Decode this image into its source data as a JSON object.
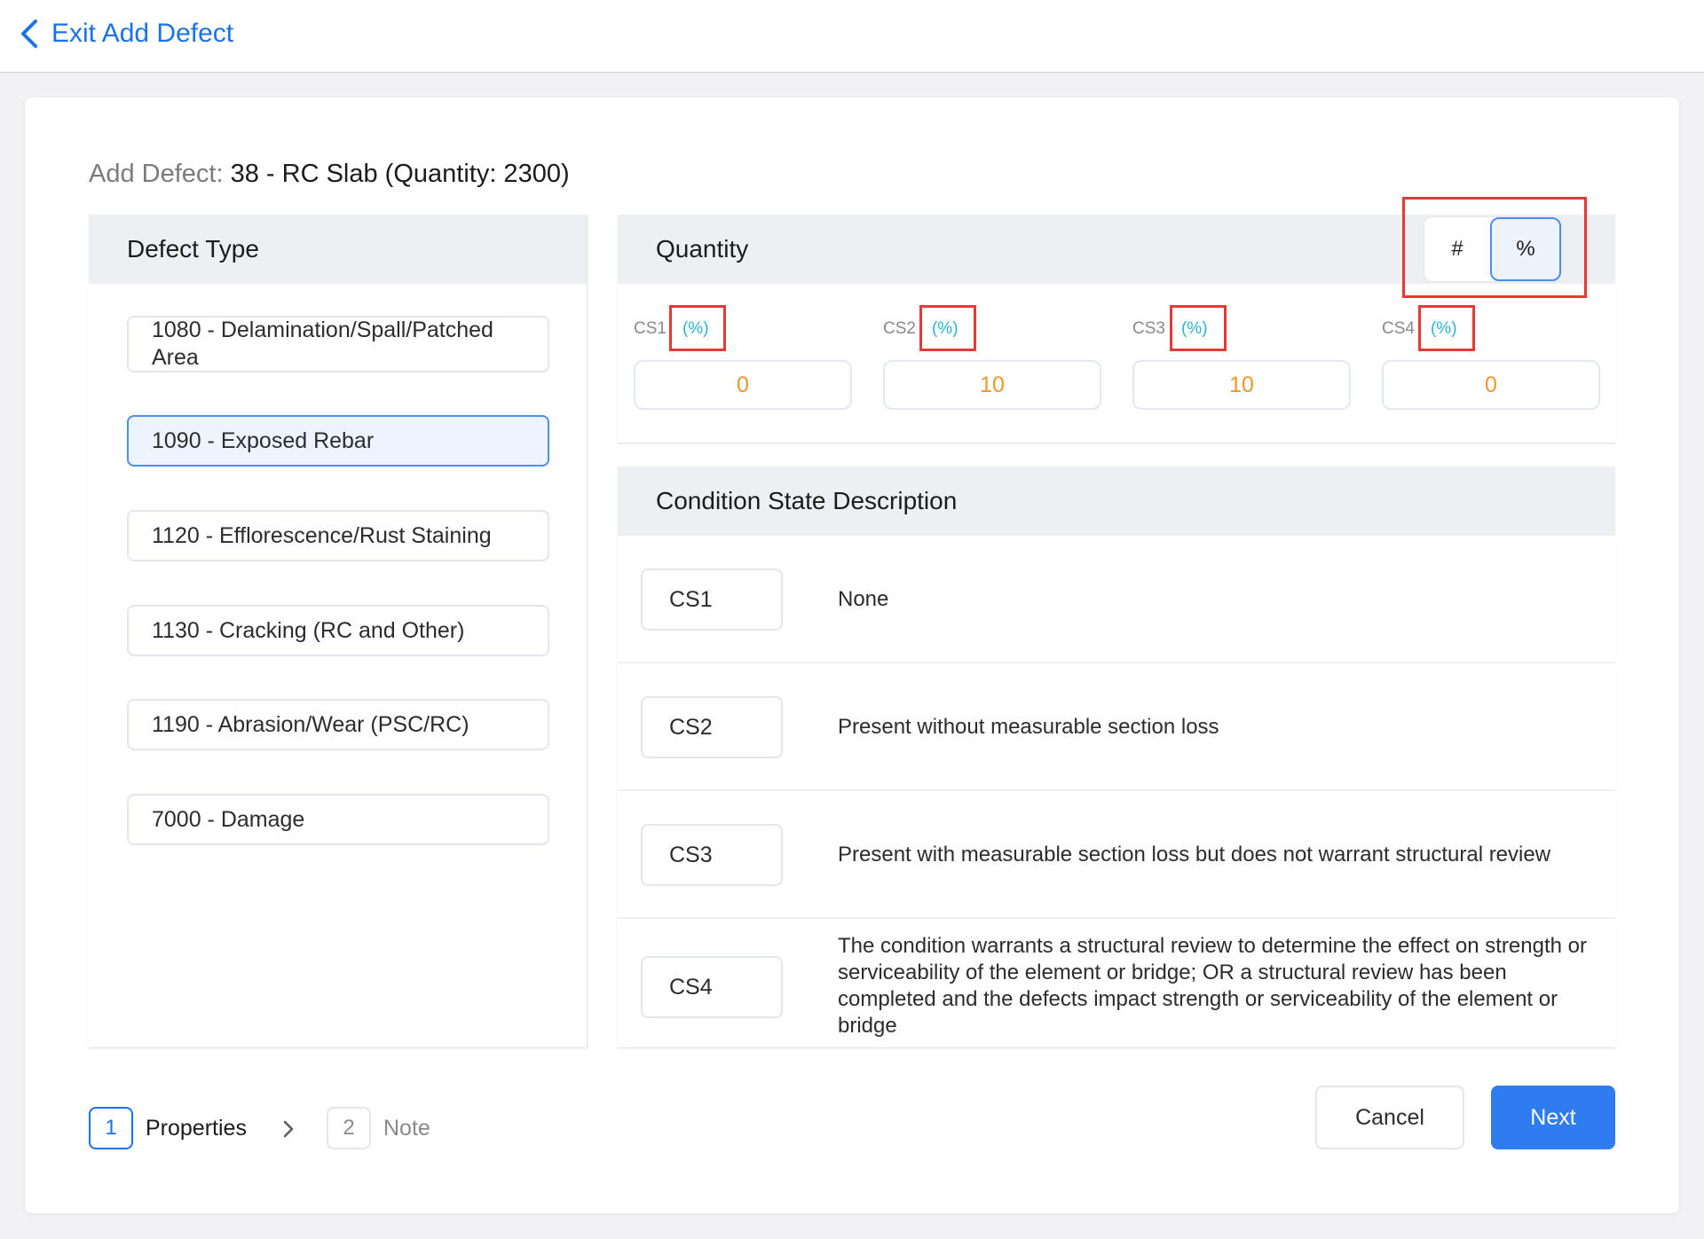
{
  "header": {
    "back_label": "Exit Add Defect"
  },
  "page": {
    "title_prefix": "Add Defect:",
    "title_value": "38 - RC Slab (Quantity: 2300)"
  },
  "defect_type": {
    "heading": "Defect Type",
    "items": [
      {
        "label": "1080 - Delamination/Spall/Patched Area",
        "selected": false
      },
      {
        "label": "1090 - Exposed Rebar",
        "selected": true
      },
      {
        "label": "1120 - Efflorescence/Rust Staining",
        "selected": false
      },
      {
        "label": "1130 - Cracking (RC and Other)",
        "selected": false
      },
      {
        "label": "1190 - Abrasion/Wear (PSC/RC)",
        "selected": false
      },
      {
        "label": "7000 - Damage",
        "selected": false
      }
    ]
  },
  "quantity": {
    "heading": "Quantity",
    "toggle": {
      "count_label": "#",
      "percent_label": "%",
      "active": "%"
    },
    "fields": [
      {
        "label": "CS1",
        "unit": "(%)",
        "value": "0"
      },
      {
        "label": "CS2",
        "unit": "(%)",
        "value": "10"
      },
      {
        "label": "CS3",
        "unit": "(%)",
        "value": "10"
      },
      {
        "label": "CS4",
        "unit": "(%)",
        "value": "0"
      }
    ]
  },
  "condition_state": {
    "heading": "Condition State Description",
    "rows": [
      {
        "code": "CS1",
        "description": "None"
      },
      {
        "code": "CS2",
        "description": "Present without measurable section loss"
      },
      {
        "code": "CS3",
        "description": "Present with measurable section loss but does not warrant structural review"
      },
      {
        "code": "CS4",
        "description": "The condition warrants a structural review to determine the effect on strength or serviceability of the element or bridge; OR a structural review has been completed and the defects impact strength or serviceability of the element or bridge"
      }
    ]
  },
  "steps": [
    {
      "number": "1",
      "label": "Properties",
      "active": true
    },
    {
      "number": "2",
      "label": "Note",
      "active": false
    }
  ],
  "actions": {
    "cancel_label": "Cancel",
    "next_label": "Next"
  },
  "colors": {
    "accent": "#1a73e8",
    "primary_button": "#2f7cf0",
    "value_orange": "#f0962b",
    "unit_cyan": "#25b6d6",
    "highlight_red": "#e53935"
  }
}
